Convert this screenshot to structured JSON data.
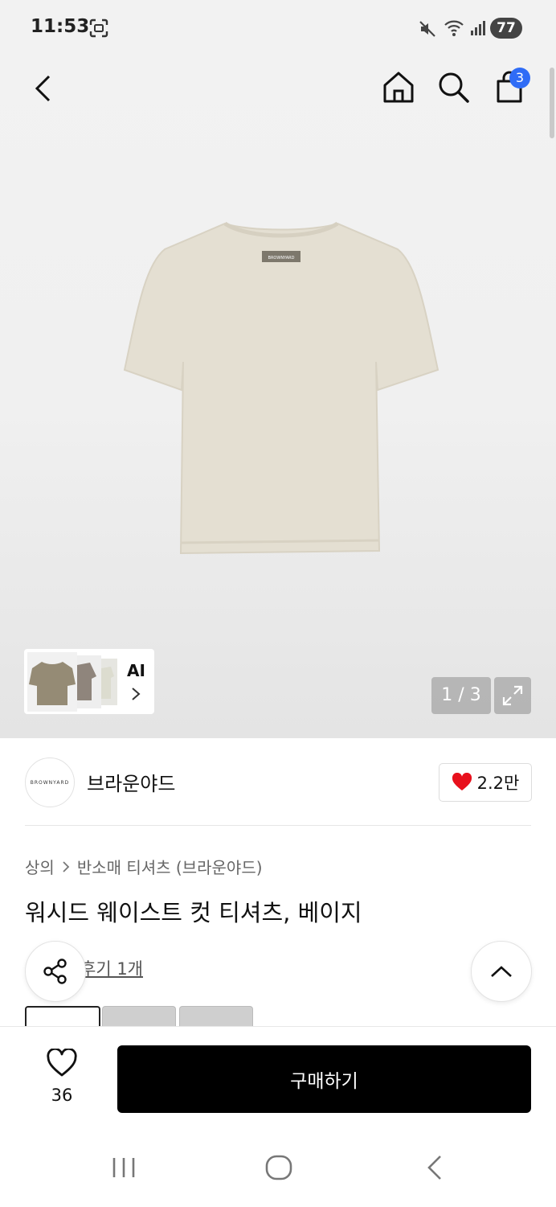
{
  "status_bar": {
    "time": "11:53",
    "battery": "77"
  },
  "header": {
    "cart_count": "3"
  },
  "gallery": {
    "ai_label": "AI",
    "counter": "1 / 3",
    "product_logo_text": "BROWNYARD"
  },
  "brand": {
    "logo_text": "BROWNYARD",
    "name": "브라운야드",
    "like_count": "2.2만"
  },
  "breadcrumb": {
    "category": "상의",
    "subcategory": "반소매 티셔츠 (브라운야드)"
  },
  "product": {
    "title": "워시드 웨이스트 컷 티셔츠, 베이지",
    "review_link": "후기 1개"
  },
  "bottom_bar": {
    "wish_count": "36",
    "buy_label": "구매하기"
  },
  "colors": {
    "accent_badge": "#2f6cf6",
    "heart_red": "#e8101c",
    "buy_button": "#000000",
    "product_beige": "#e4dfd2"
  },
  "icons": [
    "back-icon",
    "home-icon",
    "search-icon",
    "shopping-bag-icon",
    "chevron-right-icon",
    "expand-icon",
    "heart-icon",
    "share-icon",
    "chevron-up-icon",
    "recent-apps-icon",
    "home-nav-icon",
    "back-nav-icon",
    "mute-icon",
    "wifi-icon",
    "signal-icon",
    "screenshot-icon"
  ]
}
